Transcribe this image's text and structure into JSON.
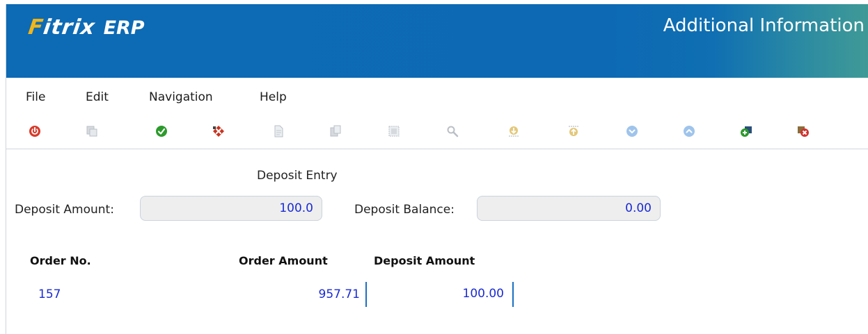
{
  "header": {
    "logo_text": "Fitrix",
    "logo_suffix": "ERP",
    "title": "Additional Information"
  },
  "menu": [
    {
      "label": "File"
    },
    {
      "label": "Edit"
    },
    {
      "label": "Navigation"
    },
    {
      "label": "Help"
    }
  ],
  "toolbar": {
    "icons": [
      "power-icon",
      "copy-icon",
      "accept-icon",
      "cancel-icon",
      "document-icon",
      "paste-icon",
      "select-icon",
      "search-icon",
      "download-icon",
      "upload-icon",
      "next-icon",
      "previous-icon",
      "add-row-icon",
      "delete-row-icon"
    ],
    "colors": {
      "power": "#d83a2a",
      "accept": "#2c9a2c",
      "cancel": "#c9331f",
      "nav": "#7fb3e6",
      "disabled": "#b9bfc6"
    }
  },
  "form": {
    "section_title": "Deposit Entry",
    "deposit_amount_label": "Deposit Amount:",
    "deposit_amount_value": "100.0",
    "deposit_balance_label": "Deposit Balance:",
    "deposit_balance_value": "0.00"
  },
  "table": {
    "columns": [
      "Order No.",
      "Order Amount",
      "Deposit Amount"
    ],
    "rows": [
      {
        "order_no": "157",
        "order_amount": "957.71",
        "deposit_amount": "100.00"
      }
    ]
  }
}
